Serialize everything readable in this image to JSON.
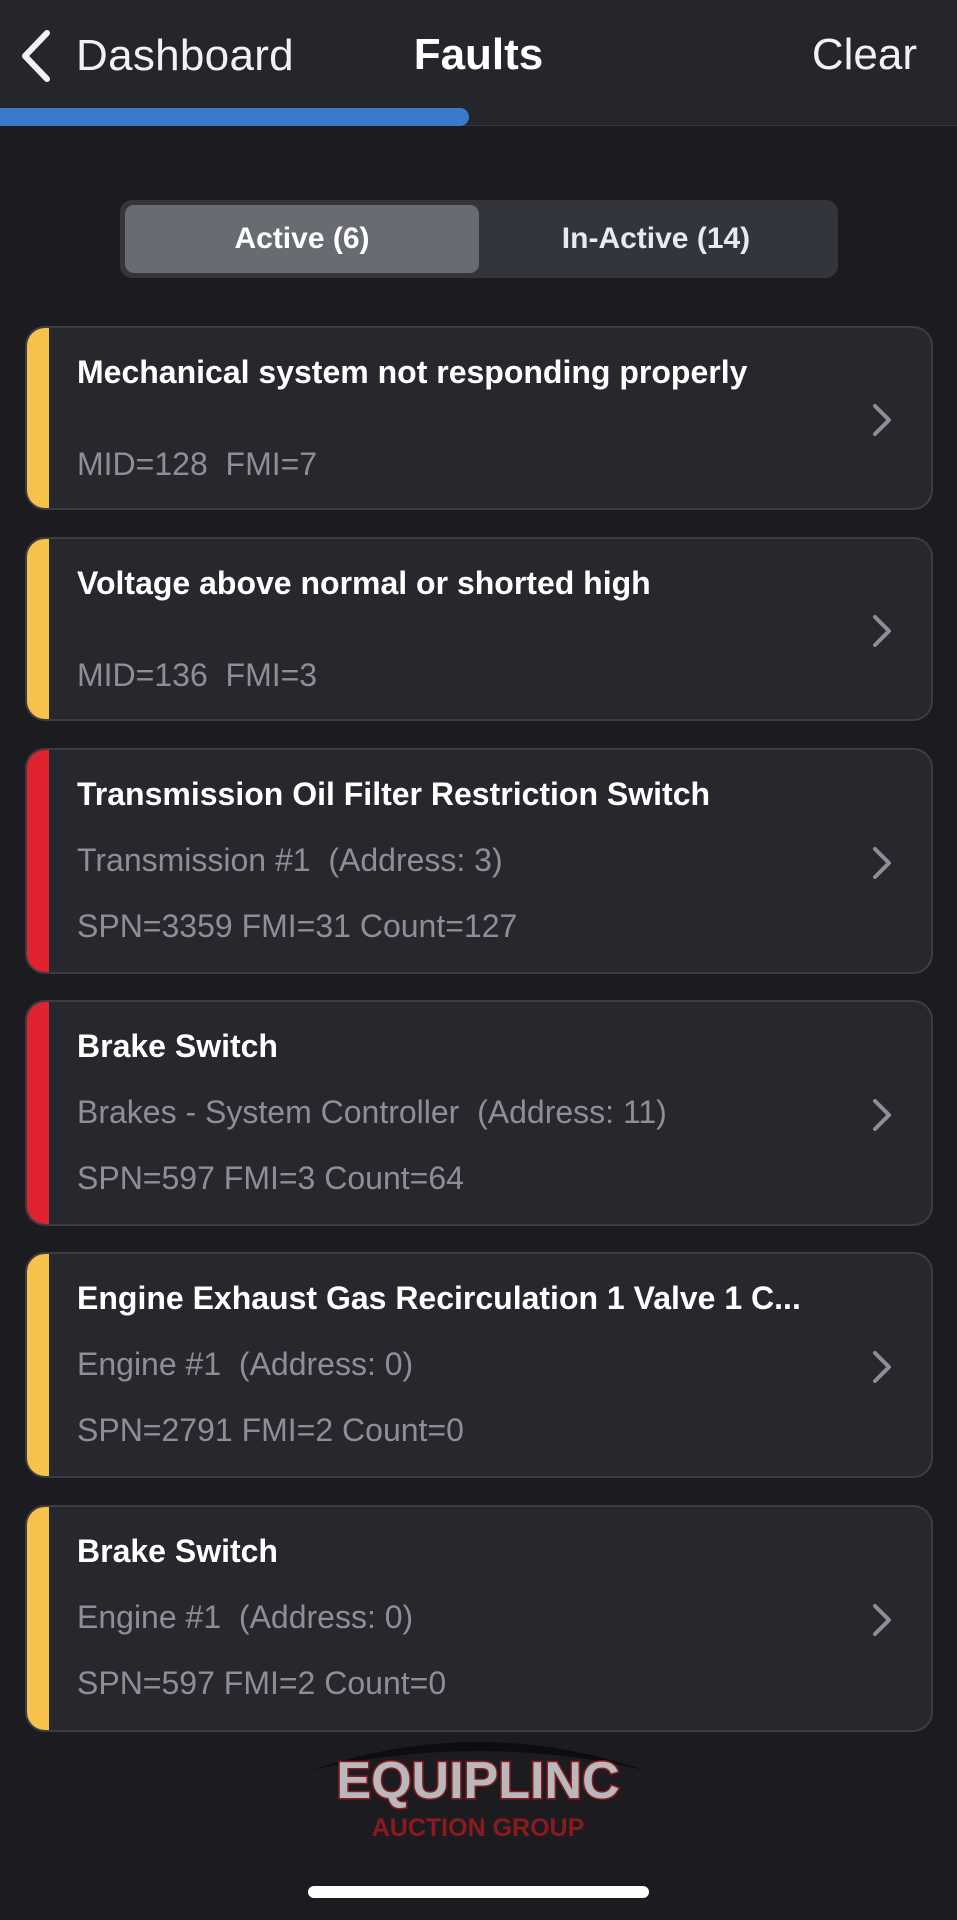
{
  "nav": {
    "back_label": "Dashboard",
    "title": "Faults",
    "clear_label": "Clear",
    "back_icon": "chevron-left-icon"
  },
  "progress": {
    "fraction": 0.49,
    "color": "#3b79c9"
  },
  "tabs": [
    {
      "label": "Active (6)",
      "selected": true
    },
    {
      "label": "In-Active (14)",
      "selected": false
    }
  ],
  "faults": [
    {
      "title": "Mechanical system not responding properly",
      "source": "",
      "codes": "MID=128  FMI=7",
      "severity_color": "#f8c14c"
    },
    {
      "title": "Voltage above normal or shorted high",
      "source": "",
      "codes": "MID=136  FMI=3",
      "severity_color": "#f8c14c"
    },
    {
      "title": "Transmission Oil Filter Restriction Switch",
      "source": "Transmission #1  (Address: 3)",
      "codes": "SPN=3359 FMI=31 Count=127",
      "severity_color": "#e0242f"
    },
    {
      "title": "Brake Switch",
      "source": "Brakes - System Controller  (Address: 11)",
      "codes": "SPN=597 FMI=3 Count=64",
      "severity_color": "#e0242f"
    },
    {
      "title": "Engine Exhaust Gas Recirculation 1 Valve 1 C...",
      "source": "Engine #1  (Address: 0)",
      "codes": "SPN=2791 FMI=2 Count=0",
      "severity_color": "#f8c14c"
    },
    {
      "title": "Brake Switch",
      "source": "Engine #1  (Address: 0)",
      "codes": "SPN=597 FMI=2 Count=0",
      "severity_color": "#f8c14c"
    }
  ],
  "watermark": {
    "brand": "EQUIPLINC",
    "tagline": "AUCTION GROUP",
    "color": "#8b1a1f"
  },
  "colors": {
    "background": "#1c1c20",
    "card": "#27282e",
    "secondary_text": "#8e8f96"
  }
}
